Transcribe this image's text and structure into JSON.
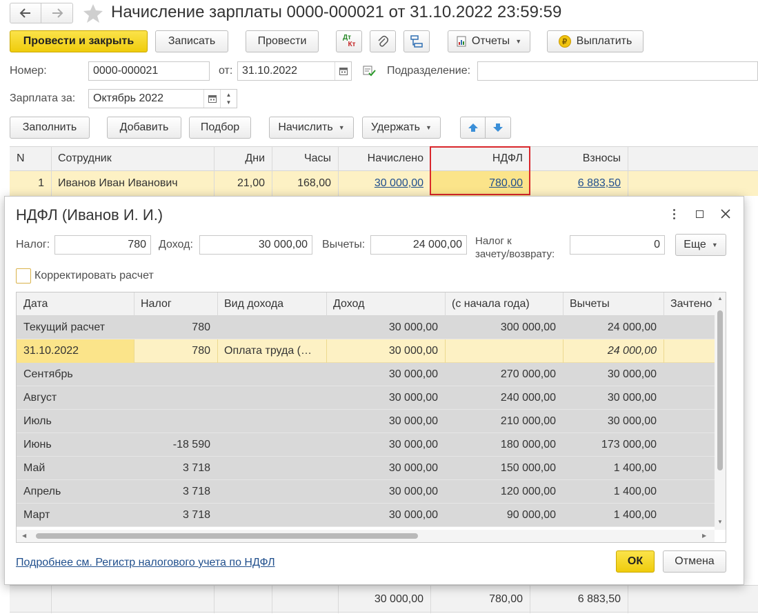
{
  "window": {
    "title": "Начисление зарплаты 0000-000021 от 31.10.2022 23:59:59"
  },
  "toolbar": {
    "post_close": "Провести и закрыть",
    "save": "Записать",
    "post": "Провести",
    "dtkt_top": "Дт",
    "dtkt_bottom": "Кт",
    "reports": "Отчеты",
    "pay": "Выплатить",
    "pay_coin": "₽"
  },
  "form": {
    "number_label": "Номер:",
    "number": "0000-000021",
    "date_label": "от:",
    "date": "31.10.2022",
    "division_label": "Подразделение:",
    "division": "",
    "salary_for_label": "Зарплата за:",
    "salary_for": "Октябрь 2022"
  },
  "actions": {
    "fill": "Заполнить",
    "add": "Добавить",
    "select": "Подбор",
    "accrue": "Начислить",
    "withhold": "Удержать"
  },
  "table": {
    "headers": [
      "N",
      "Сотрудник",
      "Дни",
      "Часы",
      "Начислено",
      "НДФЛ",
      "Взносы"
    ],
    "row": {
      "n": "1",
      "employee": "Иванов Иван Иванович",
      "days": "21,00",
      "hours": "168,00",
      "accrued": "30 000,00",
      "ndfl": "780,00",
      "contributions": "6 883,50"
    },
    "totals": {
      "accrued": "30 000,00",
      "ndfl": "780,00",
      "contributions": "6 883,50"
    }
  },
  "dialog": {
    "title": "НДФЛ (Иванов И. И.)",
    "tax_label": "Налог:",
    "tax": "780",
    "income_label": "Доход:",
    "income": "30 000,00",
    "deductions_label": "Вычеты:",
    "deductions": "24 000,00",
    "offset_label_1": "Налог к",
    "offset_label_2": "зачету/возврату:",
    "offset": "0",
    "more": "Еще",
    "correct_label": "Корректировать расчет",
    "correct_checked": false,
    "headers": [
      "Дата",
      "Налог",
      "Вид дохода",
      "Доход",
      "(с начала года)",
      "Вычеты",
      "Зачтено"
    ],
    "rows": [
      {
        "date": "Текущий расчет",
        "tax": "780",
        "kind": "",
        "income": "30 000,00",
        "ytd": "300 000,00",
        "deductions": "24 000,00",
        "offset": ""
      },
      {
        "date": "31.10.2022",
        "tax": "780",
        "kind": "Оплата труда (…",
        "income": "30 000,00",
        "ytd": "",
        "deductions": "24 000,00",
        "offset": ""
      },
      {
        "date": "Сентябрь",
        "tax": "",
        "kind": "",
        "income": "30 000,00",
        "ytd": "270 000,00",
        "deductions": "30 000,00",
        "offset": ""
      },
      {
        "date": "Август",
        "tax": "",
        "kind": "",
        "income": "30 000,00",
        "ytd": "240 000,00",
        "deductions": "30 000,00",
        "offset": ""
      },
      {
        "date": "Июль",
        "tax": "",
        "kind": "",
        "income": "30 000,00",
        "ytd": "210 000,00",
        "deductions": "30 000,00",
        "offset": ""
      },
      {
        "date": "Июнь",
        "tax": "-18 590",
        "kind": "",
        "income": "30 000,00",
        "ytd": "180 000,00",
        "deductions": "173 000,00",
        "offset": ""
      },
      {
        "date": "Май",
        "tax": "3 718",
        "kind": "",
        "income": "30 000,00",
        "ytd": "150 000,00",
        "deductions": "1 400,00",
        "offset": ""
      },
      {
        "date": "Апрель",
        "tax": "3 718",
        "kind": "",
        "income": "30 000,00",
        "ytd": "120 000,00",
        "deductions": "1 400,00",
        "offset": ""
      },
      {
        "date": "Март",
        "tax": "3 718",
        "kind": "",
        "income": "30 000,00",
        "ytd": "90 000,00",
        "deductions": "1 400,00",
        "offset": ""
      }
    ],
    "register_link": "Подробнее см. Регистр налогового учета по НДФЛ",
    "ok": "ОК",
    "cancel": "Отмена"
  },
  "colors": {
    "accent_yellow": "#f5d81c",
    "selected_row": "#fdf1c4",
    "highlight_border": "#d9262b",
    "link": "#1f4e8c"
  }
}
